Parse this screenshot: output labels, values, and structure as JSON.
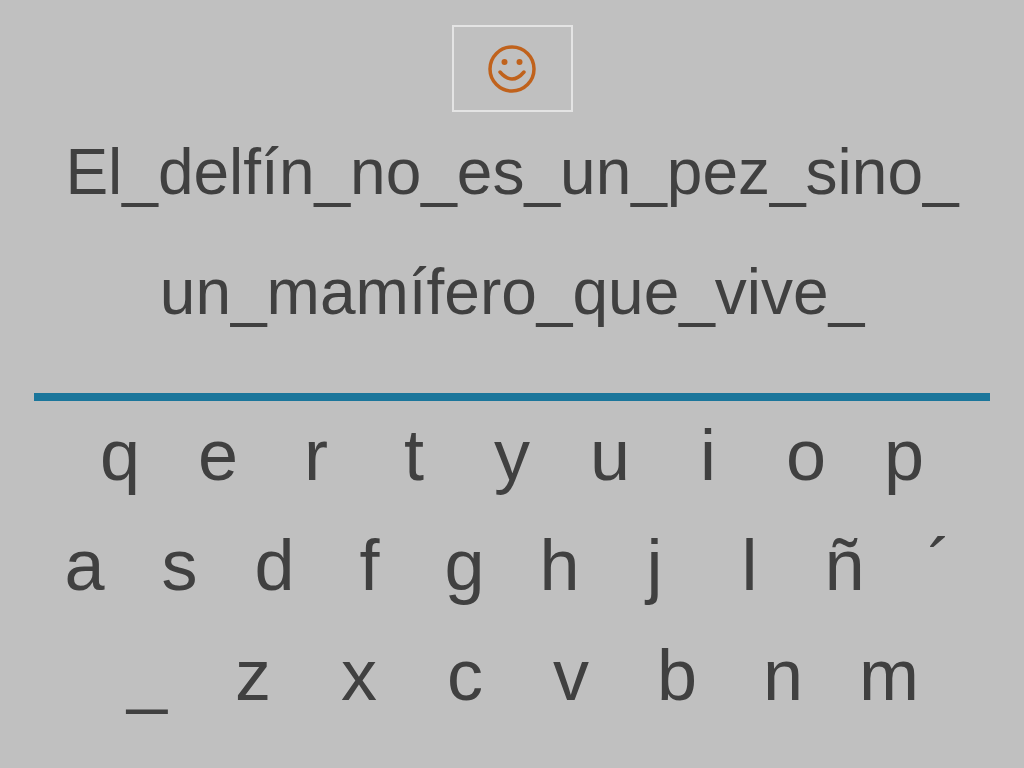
{
  "sentence_lines": [
    "El_delfín_no_es_un_pez_sino_",
    "un_mamífero_que_vive_"
  ],
  "keyboard_rows": [
    [
      "q",
      "e",
      "r",
      "t",
      "y",
      "u",
      "i",
      "o",
      "p"
    ],
    [
      "a",
      "s",
      "d",
      "f",
      "g",
      "h",
      "j",
      "l",
      "ñ",
      "´"
    ],
    [
      "_",
      "z",
      "x",
      "c",
      "v",
      "b",
      "n",
      "m"
    ]
  ]
}
